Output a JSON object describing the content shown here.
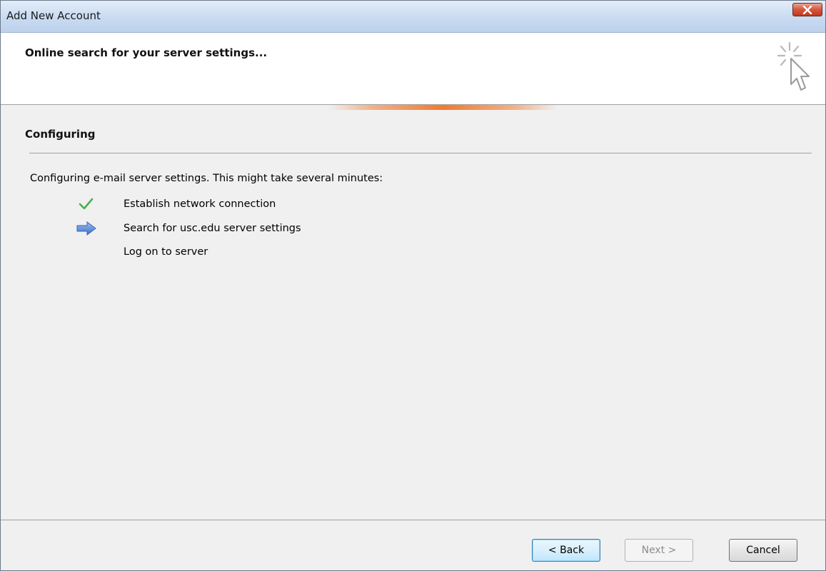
{
  "window": {
    "title": "Add New Account",
    "close_icon": "close-icon"
  },
  "header": {
    "title": "Online search for your server settings...",
    "icon": "wizard-cursor-icon",
    "progress_accent": "#f07a30"
  },
  "section": {
    "title": "Configuring",
    "intro": "Configuring e-mail server settings. This might take several minutes:"
  },
  "steps": [
    {
      "label": "Establish network connection",
      "status": "done",
      "icon": "checkmark-icon",
      "color": "#4caf50"
    },
    {
      "label": "Search for usc.edu server settings",
      "status": "in-progress",
      "icon": "arrow-right-icon",
      "color": "#4a7fd4"
    },
    {
      "label": "Log on to server",
      "status": "pending",
      "icon": ""
    }
  ],
  "buttons": {
    "back": "< Back",
    "next": "Next >",
    "cancel": "Cancel"
  }
}
